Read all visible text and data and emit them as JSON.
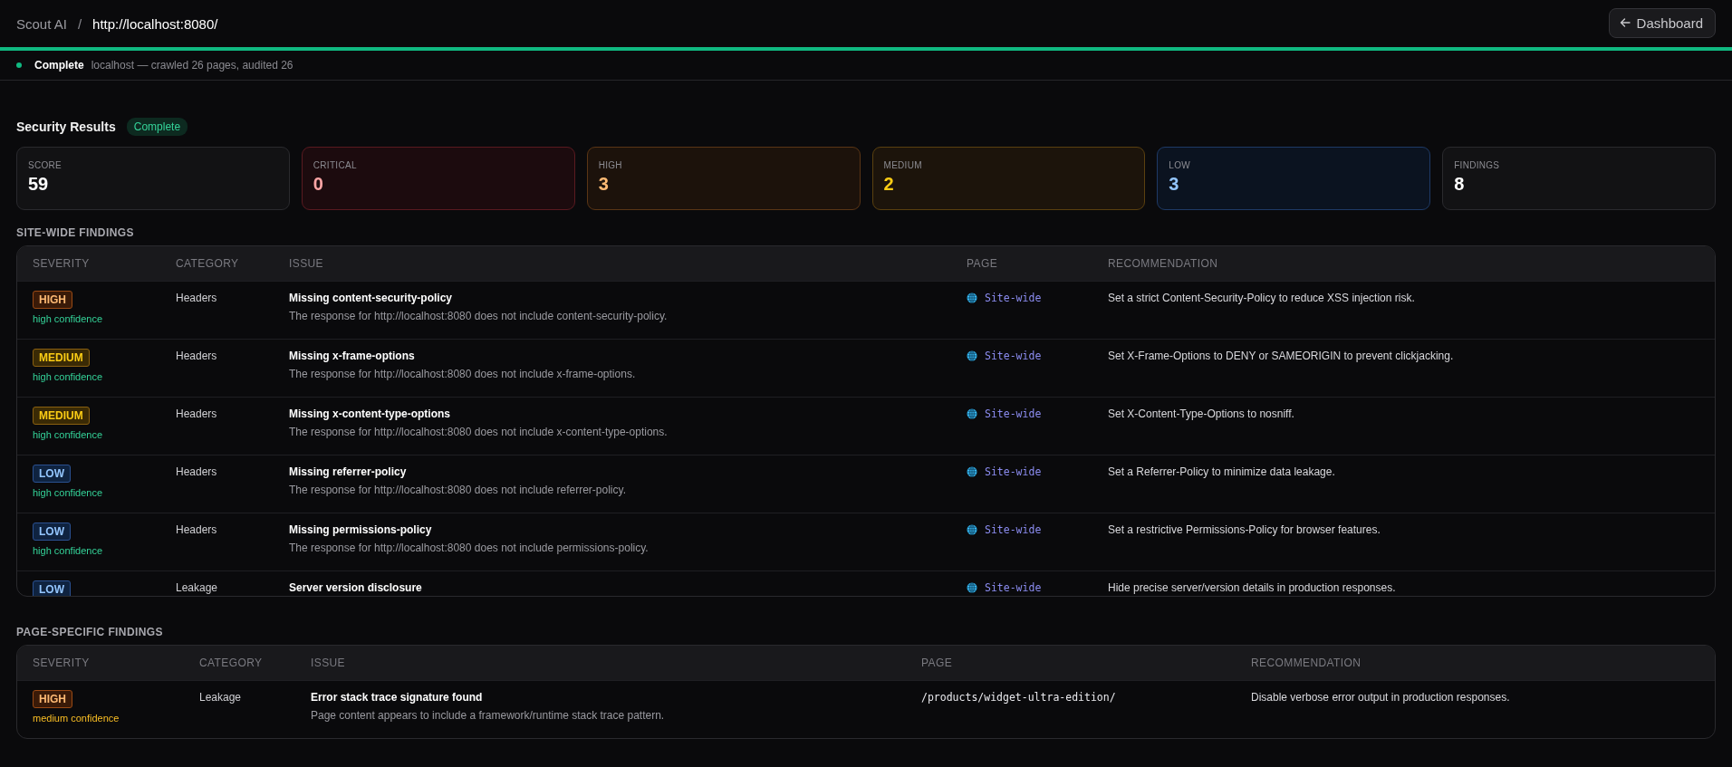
{
  "breadcrumb": {
    "app": "Scout AI",
    "separator": "/",
    "url": "http://localhost:8080/"
  },
  "back_button": {
    "label": "Dashboard"
  },
  "progress": {
    "level": 1
  },
  "status": {
    "label": "Complete",
    "detail": "localhost — crawled 26 pages, audited 26",
    "color": "#10b981"
  },
  "results": {
    "title": "Security Results",
    "badge": "Complete"
  },
  "cards": [
    {
      "kind": "neutral",
      "label": "SCORE",
      "value": "59"
    },
    {
      "kind": "critical",
      "label": "CRITICAL",
      "value": "0"
    },
    {
      "kind": "high",
      "label": "HIGH",
      "value": "3"
    },
    {
      "kind": "medium",
      "label": "MEDIUM",
      "value": "2"
    },
    {
      "kind": "low",
      "label": "LOW",
      "value": "3"
    },
    {
      "kind": "neutral",
      "label": "FINDINGS",
      "value": "8"
    }
  ],
  "site_wide": {
    "title": "SITE-WIDE FINDINGS",
    "columns": [
      "SEVERITY",
      "CATEGORY",
      "ISSUE",
      "PAGE",
      "RECOMMENDATION"
    ],
    "rows": [
      {
        "severity": {
          "kind": "high",
          "label": "HIGH"
        },
        "confidence": {
          "kind": "high",
          "text": "high confidence"
        },
        "category": "Headers",
        "issue": "Missing content-security-policy",
        "description": "The response for http://localhost:8080 does not include content-security-policy.",
        "page": {
          "kind": "site",
          "text": "Site-wide"
        },
        "recommendation": "Set a strict Content-Security-Policy to reduce XSS injection risk."
      },
      {
        "severity": {
          "kind": "medium",
          "label": "MEDIUM"
        },
        "confidence": {
          "kind": "high",
          "text": "high confidence"
        },
        "category": "Headers",
        "issue": "Missing x-frame-options",
        "description": "The response for http://localhost:8080 does not include x-frame-options.",
        "page": {
          "kind": "site",
          "text": "Site-wide"
        },
        "recommendation": "Set X-Frame-Options to DENY or SAMEORIGIN to prevent clickjacking."
      },
      {
        "severity": {
          "kind": "medium",
          "label": "MEDIUM"
        },
        "confidence": {
          "kind": "high",
          "text": "high confidence"
        },
        "category": "Headers",
        "issue": "Missing x-content-type-options",
        "description": "The response for http://localhost:8080 does not include x-content-type-options.",
        "page": {
          "kind": "site",
          "text": "Site-wide"
        },
        "recommendation": "Set X-Content-Type-Options to nosniff."
      },
      {
        "severity": {
          "kind": "low",
          "label": "LOW"
        },
        "confidence": {
          "kind": "high",
          "text": "high confidence"
        },
        "category": "Headers",
        "issue": "Missing referrer-policy",
        "description": "The response for http://localhost:8080 does not include referrer-policy.",
        "page": {
          "kind": "site",
          "text": "Site-wide"
        },
        "recommendation": "Set a Referrer-Policy to minimize data leakage."
      },
      {
        "severity": {
          "kind": "low",
          "label": "LOW"
        },
        "confidence": {
          "kind": "high",
          "text": "high confidence"
        },
        "category": "Headers",
        "issue": "Missing permissions-policy",
        "description": "The response for http://localhost:8080 does not include permissions-policy.",
        "page": {
          "kind": "site",
          "text": "Site-wide"
        },
        "recommendation": "Set a restrictive Permissions-Policy for browser features."
      },
      {
        "severity": {
          "kind": "low",
          "label": "LOW"
        },
        "category": "Leakage",
        "issue": "Server version disclosure",
        "page": {
          "kind": "site",
          "text": "Site-wide"
        },
        "recommendation": "Hide precise server/version details in production responses."
      }
    ]
  },
  "page_specific": {
    "title": "PAGE-SPECIFIC FINDINGS",
    "columns": [
      "SEVERITY",
      "CATEGORY",
      "ISSUE",
      "PAGE",
      "RECOMMENDATION"
    ],
    "rows": [
      {
        "severity": {
          "kind": "high",
          "label": "HIGH"
        },
        "confidence": {
          "kind": "medium",
          "text": "medium confidence"
        },
        "category": "Leakage",
        "issue": "Error stack trace signature found",
        "description": "Page content appears to include a framework/runtime stack trace pattern.",
        "page": {
          "kind": "path",
          "text": "/products/widget-ultra-edition/"
        },
        "recommendation": "Disable verbose error output in production responses."
      }
    ]
  }
}
